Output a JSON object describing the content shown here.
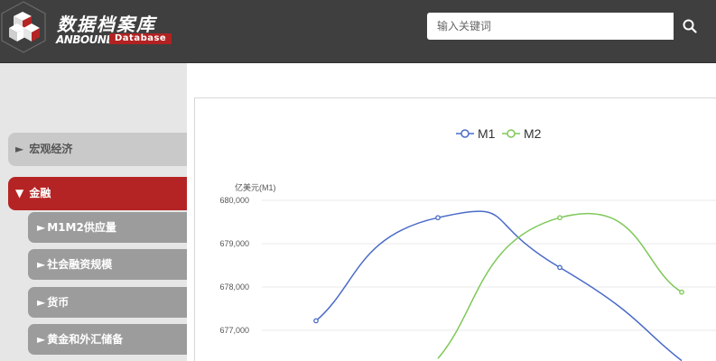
{
  "header": {
    "brand_cn": "数据档案库",
    "brand_en": "ANBOUND",
    "brand_db": "Database",
    "search_placeholder": "输入关键词"
  },
  "sidebar": {
    "items": [
      {
        "label": "宏观经济",
        "arrow": "►",
        "state": "collapsed"
      },
      {
        "label": "金融",
        "arrow": "▼",
        "state": "active"
      }
    ],
    "subitems": [
      {
        "label": "M1M2供应量",
        "arrow": "►"
      },
      {
        "label": "社会融资规模",
        "arrow": "►"
      },
      {
        "label": "货币",
        "arrow": "►"
      },
      {
        "label": "黄金和外汇储备",
        "arrow": "►"
      }
    ]
  },
  "chart_data": {
    "type": "line",
    "ylabel": "亿美元(M1)",
    "yticks": [
      "680,000",
      "679,000",
      "678,000",
      "677,000"
    ],
    "ylim": [
      676300,
      680000
    ],
    "series": [
      {
        "name": "M1",
        "color": "#4a6bc8",
        "points": [
          [
            0,
            677220
          ],
          [
            1,
            679600
          ],
          [
            2,
            678450
          ],
          [
            3,
            676300
          ]
        ]
      },
      {
        "name": "M2",
        "color": "#7ec85a",
        "points": [
          [
            1,
            676350
          ],
          [
            2,
            679600
          ],
          [
            3,
            677880
          ]
        ]
      }
    ]
  }
}
